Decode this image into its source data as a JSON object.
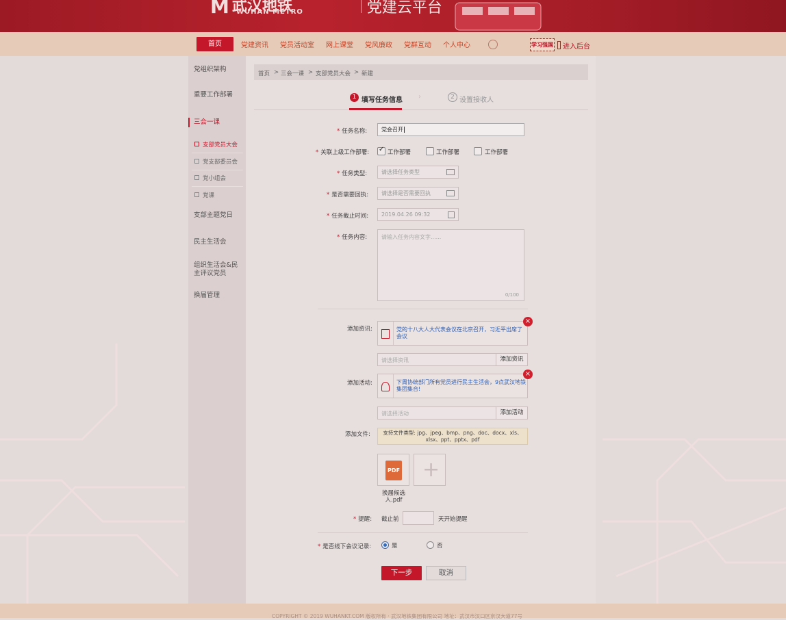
{
  "brand": {
    "logo_cn": "武汉地铁",
    "logo_en": "WUHAN METRO",
    "title": "党建云平台"
  },
  "nav": {
    "items": [
      "首页",
      "党建资讯",
      "党员活动室",
      "网上课堂",
      "党风廉政",
      "党群互动",
      "个人中心"
    ],
    "admin_badge": "学习强国",
    "admin_label": "进入后台"
  },
  "sidebar": {
    "items": [
      "党组织架构",
      "重要工作部署",
      "三会一课",
      "支部主题党日",
      "民主生活会",
      "组织生活会&民主评议党员",
      "换届管理"
    ],
    "active": "三会一课",
    "sub_items": [
      "支部党员大会",
      "党支部委员会",
      "党小组会",
      "党课"
    ],
    "active_sub": "支部党员大会"
  },
  "breadcrumb": [
    "首页",
    ">",
    "三会一课",
    ">",
    "支部党员大会",
    ">",
    "新建"
  ],
  "steps": {
    "step1_num": "1",
    "step1": "填写任务信息",
    "arrow": "›",
    "step2_num": "2",
    "step2": "设置接收人"
  },
  "form": {
    "required_mark": "*",
    "task_name_label": "任务名称:",
    "task_name_value": "党会召开",
    "related_label": "关联上级工作部署:",
    "related_options": [
      "工作部署",
      "工作部署",
      "工作部署"
    ],
    "related_checked": [
      true,
      false,
      false
    ],
    "task_type_label": "任务类型:",
    "task_type_placeholder": "请选择任务类型",
    "receipt_label": "是否需要回执:",
    "receipt_placeholder": "请选择是否需要回执",
    "deadline_label": "任务截止时间:",
    "deadline_placeholder": "2019.04.26  09:32",
    "content_label": "任务内容:",
    "content_placeholder": "请输入任务内容文字......",
    "content_count": "0/100",
    "news_label": "添加资讯:",
    "news_card": "党的十八大人大代表会议在北京召开，习近平出席了会议",
    "news_placeholder": "请选择资讯",
    "news_button": "添加资讯",
    "activity_label": "添加活动:",
    "activity_card": "下周协统部门所有党员进行民主生活会，9点武汉地铁集团集合!",
    "activity_placeholder": "请选择活动",
    "activity_button": "添加活动",
    "file_label": "添加文件:",
    "file_tip": "支持文件类型: jpg、jpeg、bmp、png、doc、docx、xls、xlsx、ppt、pptx、pdf",
    "file_icon_text": "PDF",
    "file_name": "换届候选人.pdf",
    "add_file_symbol": "+",
    "remind_label": "提醒:",
    "remind_prefix": "截止前",
    "remind_suffix": "天开始提醒",
    "offline_label": "是否线下会议记录:",
    "offline_yes": "是",
    "offline_no": "否",
    "offline_selected": "是",
    "close_symbol": "×"
  },
  "buttons": {
    "next": "下一步",
    "cancel": "取消"
  },
  "footer": {
    "text": "COPYRIGHT © 2019 WUHANKT.COM  版权所有 · 武汉地铁集团有限公司  地址：武汉市汉口区京汉大道77号"
  },
  "colors": {
    "brand_red": "#c4182a",
    "link_blue": "#2f5fb0",
    "nav_bg": "#e6cbb9"
  }
}
